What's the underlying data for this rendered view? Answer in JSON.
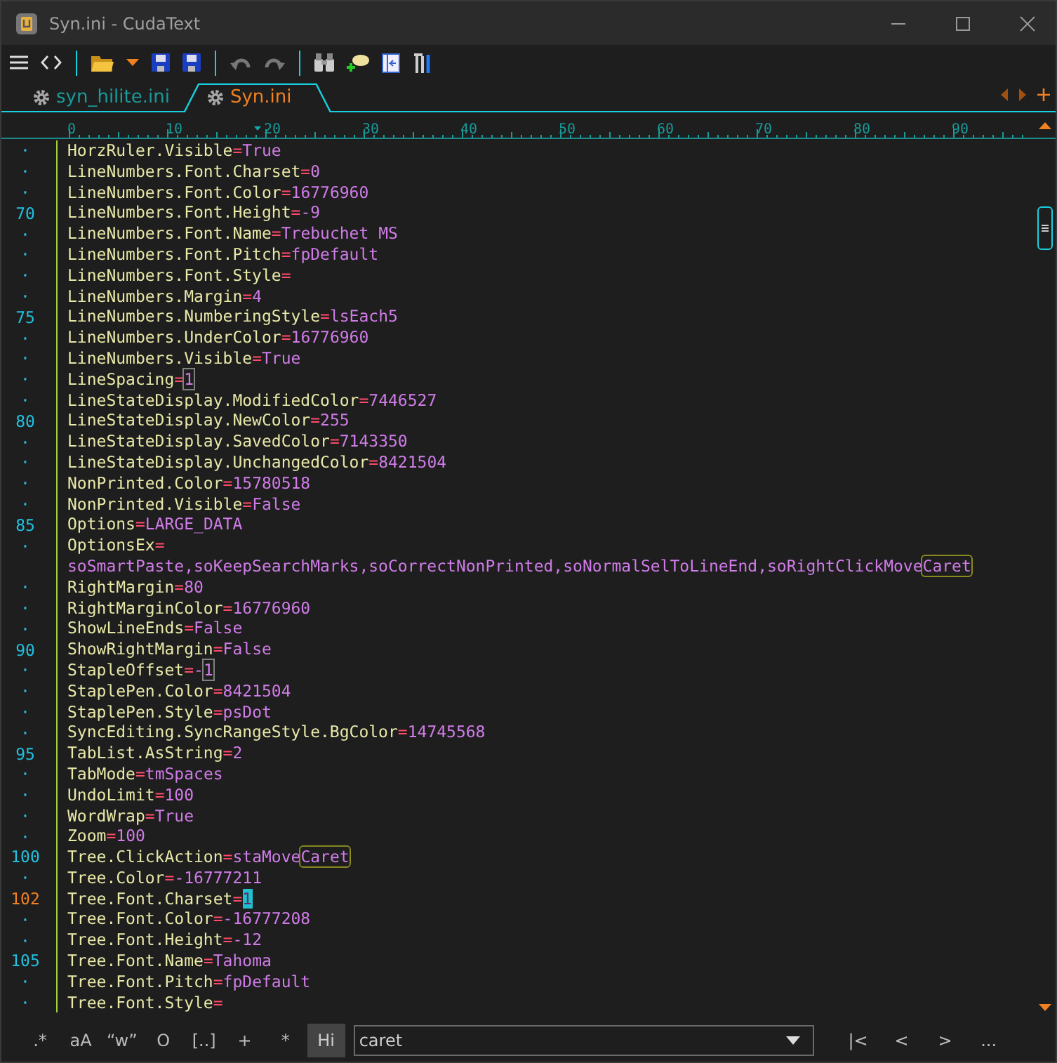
{
  "window": {
    "title": "Syn.ini - CudaText"
  },
  "tabs": [
    {
      "label": "syn_hilite.ini",
      "selected": false
    },
    {
      "label": "Syn.ini",
      "selected": true
    }
  ],
  "ruler": {
    "labels": [
      "0",
      "10",
      "20",
      "30",
      "40",
      "50",
      "60",
      "70",
      "80",
      "90"
    ]
  },
  "lines": [
    {
      "number": "·",
      "current": false,
      "key": "HorzRuler.Visible",
      "op": "=",
      "value": [
        {
          "text": "True",
          "kind": "plain"
        }
      ]
    },
    {
      "number": "·",
      "current": false,
      "key": "LineNumbers.Font.Charset",
      "op": "=",
      "value": [
        {
          "text": "0",
          "kind": "plain"
        }
      ]
    },
    {
      "number": "·",
      "current": false,
      "key": "LineNumbers.Font.Color",
      "op": "=",
      "value": [
        {
          "text": "16776960",
          "kind": "plain"
        }
      ]
    },
    {
      "number": "70",
      "current": false,
      "key": "LineNumbers.Font.Height",
      "op": "=",
      "value": [
        {
          "text": "-9",
          "kind": "plain"
        }
      ]
    },
    {
      "number": "·",
      "current": false,
      "key": "LineNumbers.Font.Name",
      "op": "=",
      "value": [
        {
          "text": "Trebuchet MS",
          "kind": "plain"
        }
      ]
    },
    {
      "number": "·",
      "current": false,
      "key": "LineNumbers.Font.Pitch",
      "op": "=",
      "value": [
        {
          "text": "fpDefault",
          "kind": "plain"
        }
      ]
    },
    {
      "number": "·",
      "current": false,
      "key": "LineNumbers.Font.Style",
      "op": "="
    },
    {
      "number": "·",
      "current": false,
      "key": "LineNumbers.Margin",
      "op": "=",
      "value": [
        {
          "text": "4",
          "kind": "plain"
        }
      ]
    },
    {
      "number": "75",
      "current": false,
      "key": "LineNumbers.NumberingStyle",
      "op": "=",
      "value": [
        {
          "text": "lsEach5",
          "kind": "plain"
        }
      ]
    },
    {
      "number": "·",
      "current": false,
      "key": "LineNumbers.UnderColor",
      "op": "=",
      "value": [
        {
          "text": "16776960",
          "kind": "plain"
        }
      ]
    },
    {
      "number": "·",
      "current": false,
      "key": "LineNumbers.Visible",
      "op": "=",
      "value": [
        {
          "text": "True",
          "kind": "plain"
        }
      ]
    },
    {
      "number": "·",
      "current": false,
      "key": "LineSpacing",
      "op": "=",
      "value": [
        {
          "text": "1",
          "kind": "caret"
        }
      ]
    },
    {
      "number": "·",
      "current": false,
      "key": "LineStateDisplay.ModifiedColor",
      "op": "=",
      "value": [
        {
          "text": "7446527",
          "kind": "plain"
        }
      ]
    },
    {
      "number": "80",
      "current": false,
      "key": "LineStateDisplay.NewColor",
      "op": "=",
      "value": [
        {
          "text": "255",
          "kind": "plain"
        }
      ]
    },
    {
      "number": "·",
      "current": false,
      "key": "LineStateDisplay.SavedColor",
      "op": "=",
      "value": [
        {
          "text": "7143350",
          "kind": "plain"
        }
      ]
    },
    {
      "number": "·",
      "current": false,
      "key": "LineStateDisplay.UnchangedColor",
      "op": "=",
      "value": [
        {
          "text": "8421504",
          "kind": "plain"
        }
      ]
    },
    {
      "number": "·",
      "current": false,
      "key": "NonPrinted.Color",
      "op": "=",
      "value": [
        {
          "text": "15780518",
          "kind": "plain"
        }
      ]
    },
    {
      "number": "·",
      "current": false,
      "key": "NonPrinted.Visible",
      "op": "=",
      "value": [
        {
          "text": "False",
          "kind": "plain"
        }
      ]
    },
    {
      "number": "85",
      "current": false,
      "key": "Options",
      "op": "=",
      "value": [
        {
          "text": "LARGE_DATA",
          "kind": "plain"
        }
      ]
    },
    {
      "number": "·",
      "current": false,
      "key": "OptionsEx",
      "op": "=",
      "wrap": [
        {
          "text": "soSmartPaste,soKeepSearchMarks,soCorrectNonPrinted,soNormalSelToLineEnd,soRightClickMove",
          "kind": "plain"
        },
        {
          "text": "Caret",
          "kind": "match"
        }
      ]
    },
    {
      "number": "·",
      "current": false,
      "key": "RightMargin",
      "op": "=",
      "value": [
        {
          "text": "80",
          "kind": "plain"
        }
      ]
    },
    {
      "number": "·",
      "current": false,
      "key": "RightMarginColor",
      "op": "=",
      "value": [
        {
          "text": "16776960",
          "kind": "plain"
        }
      ]
    },
    {
      "number": "·",
      "current": false,
      "key": "ShowLineEnds",
      "op": "=",
      "value": [
        {
          "text": "False",
          "kind": "plain"
        }
      ]
    },
    {
      "number": "90",
      "current": false,
      "key": "ShowRightMargin",
      "op": "=",
      "value": [
        {
          "text": "False",
          "kind": "plain"
        }
      ]
    },
    {
      "number": "·",
      "current": false,
      "key": "StapleOffset",
      "op": "=",
      "value": [
        {
          "text": "-",
          "kind": "plain"
        },
        {
          "text": "1",
          "kind": "caret"
        }
      ]
    },
    {
      "number": "·",
      "current": false,
      "key": "StaplePen.Color",
      "op": "=",
      "value": [
        {
          "text": "8421504",
          "kind": "plain"
        }
      ]
    },
    {
      "number": "·",
      "current": false,
      "key": "StaplePen.Style",
      "op": "=",
      "value": [
        {
          "text": "psDot",
          "kind": "plain"
        }
      ]
    },
    {
      "number": "·",
      "current": false,
      "key": "SyncEditing.SyncRangeStyle.BgColor",
      "op": "=",
      "value": [
        {
          "text": "14745568",
          "kind": "plain"
        }
      ]
    },
    {
      "number": "95",
      "current": false,
      "key": "TabList.AsString",
      "op": "=",
      "value": [
        {
          "text": "2",
          "kind": "plain"
        }
      ]
    },
    {
      "number": "·",
      "current": false,
      "key": "TabMode",
      "op": "=",
      "value": [
        {
          "text": "tmSpaces",
          "kind": "plain"
        }
      ]
    },
    {
      "number": "·",
      "current": false,
      "key": "UndoLimit",
      "op": "=",
      "value": [
        {
          "text": "100",
          "kind": "plain"
        }
      ]
    },
    {
      "number": "·",
      "current": false,
      "key": "WordWrap",
      "op": "=",
      "value": [
        {
          "text": "True",
          "kind": "plain"
        }
      ]
    },
    {
      "number": "·",
      "current": false,
      "key": "Zoom",
      "op": "=",
      "value": [
        {
          "text": "100",
          "kind": "plain"
        }
      ]
    },
    {
      "number": "100",
      "current": false,
      "key": "Tree.ClickAction",
      "op": "=",
      "value": [
        {
          "text": "staMove",
          "kind": "plain"
        },
        {
          "text": "Caret",
          "kind": "match"
        }
      ]
    },
    {
      "number": "·",
      "current": false,
      "key": "Tree.Color",
      "op": "=",
      "value": [
        {
          "text": "-16777211",
          "kind": "plain"
        }
      ]
    },
    {
      "number": "102",
      "current": true,
      "key": "Tree.Font.Charset",
      "op": "=",
      "value": [
        {
          "text": "1",
          "kind": "cursor"
        }
      ]
    },
    {
      "number": "·",
      "current": false,
      "key": "Tree.Font.Color",
      "op": "=",
      "value": [
        {
          "text": "-16777208",
          "kind": "plain"
        }
      ]
    },
    {
      "number": "·",
      "current": false,
      "key": "Tree.Font.Height",
      "op": "=",
      "value": [
        {
          "text": "-12",
          "kind": "plain"
        }
      ]
    },
    {
      "number": "105",
      "current": false,
      "key": "Tree.Font.Name",
      "op": "=",
      "value": [
        {
          "text": "Tahoma",
          "kind": "plain"
        }
      ]
    },
    {
      "number": "·",
      "current": false,
      "key": "Tree.Font.Pitch",
      "op": "=",
      "value": [
        {
          "text": "fpDefault",
          "kind": "plain"
        }
      ]
    },
    {
      "number": "·",
      "current": false,
      "key": "Tree.Font.Style",
      "op": "="
    }
  ],
  "find_options": [
    {
      "label": ".*",
      "selected": false
    },
    {
      "label": "aA",
      "selected": false
    },
    {
      "label": "“w”",
      "selected": false
    },
    {
      "label": "O",
      "selected": false
    },
    {
      "label": "[..]",
      "selected": false
    },
    {
      "label": "+",
      "selected": false
    },
    {
      "label": "*",
      "selected": false
    },
    {
      "label": "Hi",
      "selected": true
    }
  ],
  "find_field": {
    "value": "caret"
  },
  "find_nav": [
    "|<",
    "<",
    ">",
    "..."
  ]
}
